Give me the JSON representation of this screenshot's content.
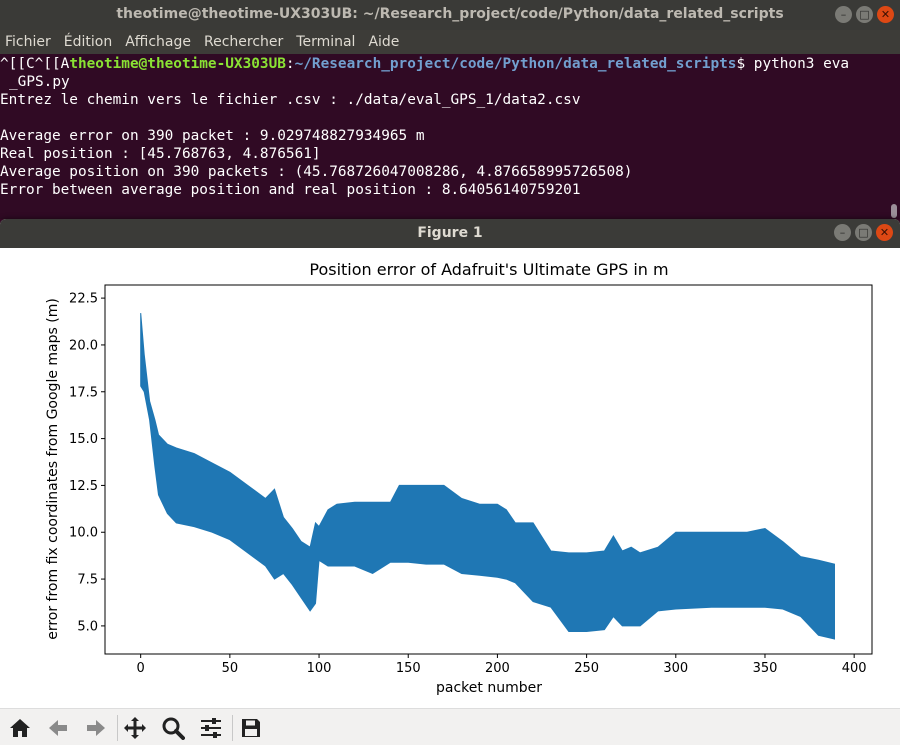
{
  "terminal": {
    "title": "theotime@theotime-UX303UB: ~/Research_project/code/Python/data_related_scripts",
    "menu": [
      "Fichier",
      "Édition",
      "Affichage",
      "Rechercher",
      "Terminal",
      "Aide"
    ],
    "prompt_prefix": "^[[C^[[A",
    "prompt_user": "theotime@theotime-UX303UB",
    "prompt_colon": ":",
    "prompt_path": "~/Research_project/code/Python/data_related_scripts",
    "prompt_command": "$ python3 eva",
    "prompt_wrap": "_GPS.py",
    "lines": [
      "Entrez le chemin vers le fichier .csv : ./data/eval_GPS_1/data2.csv",
      "",
      "Average error on 390 packet : 9.029748827934965 m",
      "Real position : [45.768763, 4.876561]",
      "Average position on 390 packets : (45.768726047008286, 4.876658995726508)",
      "Error between average position and real position : 8.64056140759201"
    ]
  },
  "figure": {
    "title": "Figure 1"
  },
  "toolbar": [
    "home-icon",
    "back-icon",
    "forward-icon",
    "pan-icon",
    "zoom-icon",
    "configure-icon",
    "save-icon"
  ],
  "chart_data": {
    "type": "area",
    "title": "Position error of Adafruit's Ultimate GPS in m",
    "xlabel": "packet number",
    "ylabel": "error from fix coordinates from Google maps (m)",
    "xlim": [
      -20,
      410
    ],
    "ylim": [
      3.5,
      23.2
    ],
    "xticks": [
      0,
      50,
      100,
      150,
      200,
      250,
      300,
      350,
      400
    ],
    "yticks": [
      5.0,
      7.5,
      10.0,
      12.5,
      15.0,
      17.5,
      20.0,
      22.5
    ],
    "color": "#1f77b4",
    "grid": false,
    "series": [
      {
        "x": [
          0,
          2,
          5,
          8,
          10,
          15,
          20,
          30,
          40,
          50,
          60,
          70,
          75,
          80,
          85,
          90,
          95,
          98,
          100,
          105,
          110,
          120,
          130,
          140,
          145,
          150,
          160,
          170,
          180,
          190,
          200,
          205,
          210,
          220,
          230,
          240,
          250,
          260,
          265,
          270,
          275,
          280,
          290,
          300,
          320,
          340,
          350,
          360,
          370,
          380,
          389
        ],
        "upper": [
          21.7,
          19.5,
          17.0,
          16.0,
          15.2,
          14.7,
          14.5,
          14.2,
          13.7,
          13.2,
          12.5,
          11.8,
          12.3,
          10.8,
          10.2,
          9.5,
          9.2,
          10.5,
          10.3,
          11.2,
          11.5,
          11.6,
          11.6,
          11.6,
          12.5,
          12.5,
          12.5,
          12.5,
          11.8,
          11.5,
          11.5,
          11.2,
          10.5,
          10.5,
          9.0,
          8.9,
          8.9,
          9.0,
          9.8,
          9.0,
          9.2,
          8.9,
          9.2,
          10.0,
          10.0,
          10.0,
          10.2,
          9.5,
          8.7,
          8.5,
          8.3
        ],
        "lower": [
          17.8,
          17.5,
          16.0,
          13.5,
          12.0,
          11.0,
          10.5,
          10.3,
          10.0,
          9.6,
          8.9,
          8.2,
          7.5,
          7.8,
          7.2,
          6.5,
          5.8,
          6.2,
          8.5,
          8.2,
          8.2,
          8.2,
          7.8,
          8.4,
          8.4,
          8.4,
          8.3,
          8.3,
          7.8,
          7.7,
          7.6,
          7.5,
          7.3,
          6.3,
          6.0,
          4.7,
          4.7,
          4.8,
          5.5,
          5.0,
          5.0,
          5.0,
          5.8,
          5.9,
          6.0,
          6.0,
          6.0,
          5.9,
          5.5,
          4.5,
          4.3
        ]
      }
    ]
  }
}
